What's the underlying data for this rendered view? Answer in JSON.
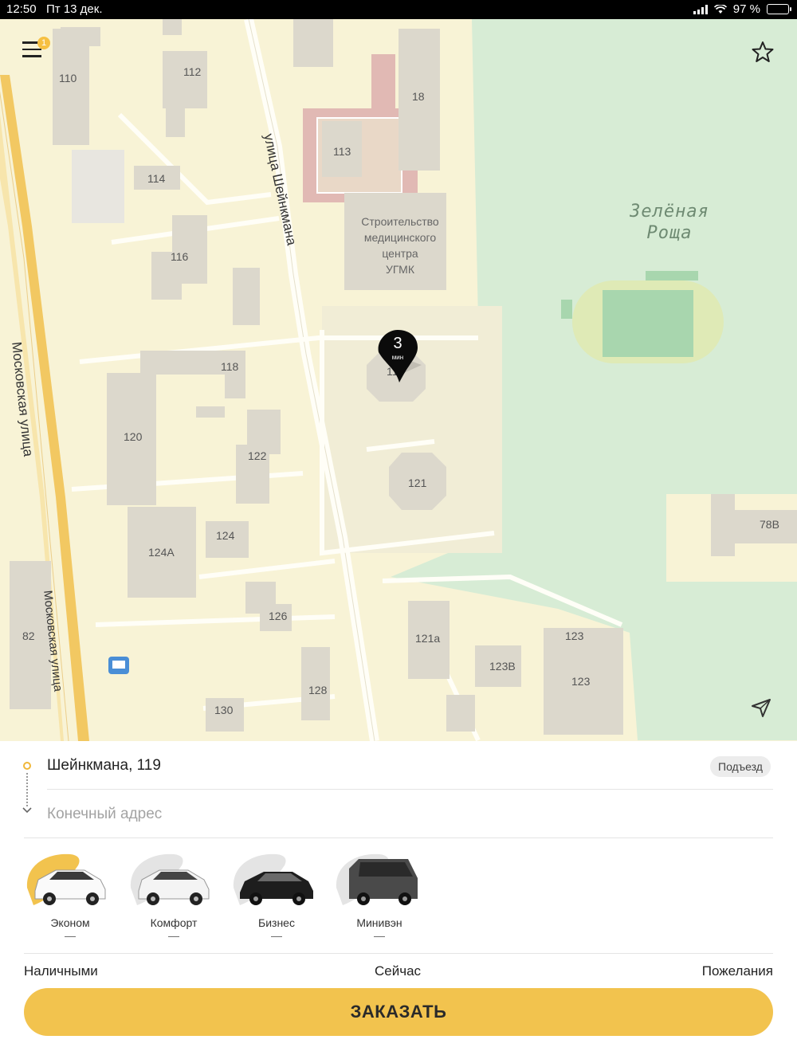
{
  "status_bar": {
    "time": "12:50",
    "date": "Пт 13 дек.",
    "battery": "97 %",
    "battery_level": 0.97
  },
  "map": {
    "menu_badge": "1",
    "house_numbers": [
      "110",
      "112",
      "18",
      "113",
      "114",
      "116",
      "118",
      "120",
      "122",
      "124",
      "124A",
      "126",
      "128",
      "130",
      "82",
      "121",
      "121a",
      "123В",
      "123",
      "123",
      "78В",
      "11"
    ],
    "streets": {
      "sheinkmana": "улица Шейнкмана",
      "moskovskaya_1": "Московская улица",
      "moskovskaya_2": "Московская улица"
    },
    "park_name": "Зелёная\nРоща",
    "building_name": "Строительство\nмедицинского\nцентра\nУГМК",
    "pin": {
      "value": "3",
      "unit": "мин"
    },
    "colors": {
      "background": "#f8f3d6",
      "park": "#d7ecd5",
      "road": "#f2c862",
      "building": "#dcd8cc"
    }
  },
  "order": {
    "from": "Шейнкмана, 119",
    "to_placeholder": "Конечный адрес",
    "entrance_label": "Подъезд",
    "tariffs": [
      {
        "name": "Эконом",
        "price": "—",
        "selected": true
      },
      {
        "name": "Комфорт",
        "price": "—",
        "selected": false
      },
      {
        "name": "Бизнес",
        "price": "—",
        "selected": false
      },
      {
        "name": "Минивэн",
        "price": "—",
        "selected": false
      }
    ],
    "payment": "Наличными",
    "time": "Сейчас",
    "wishes": "Пожелания",
    "order_button": "ЗАКАЗАТЬ",
    "accent_color": "#f2c34e"
  }
}
